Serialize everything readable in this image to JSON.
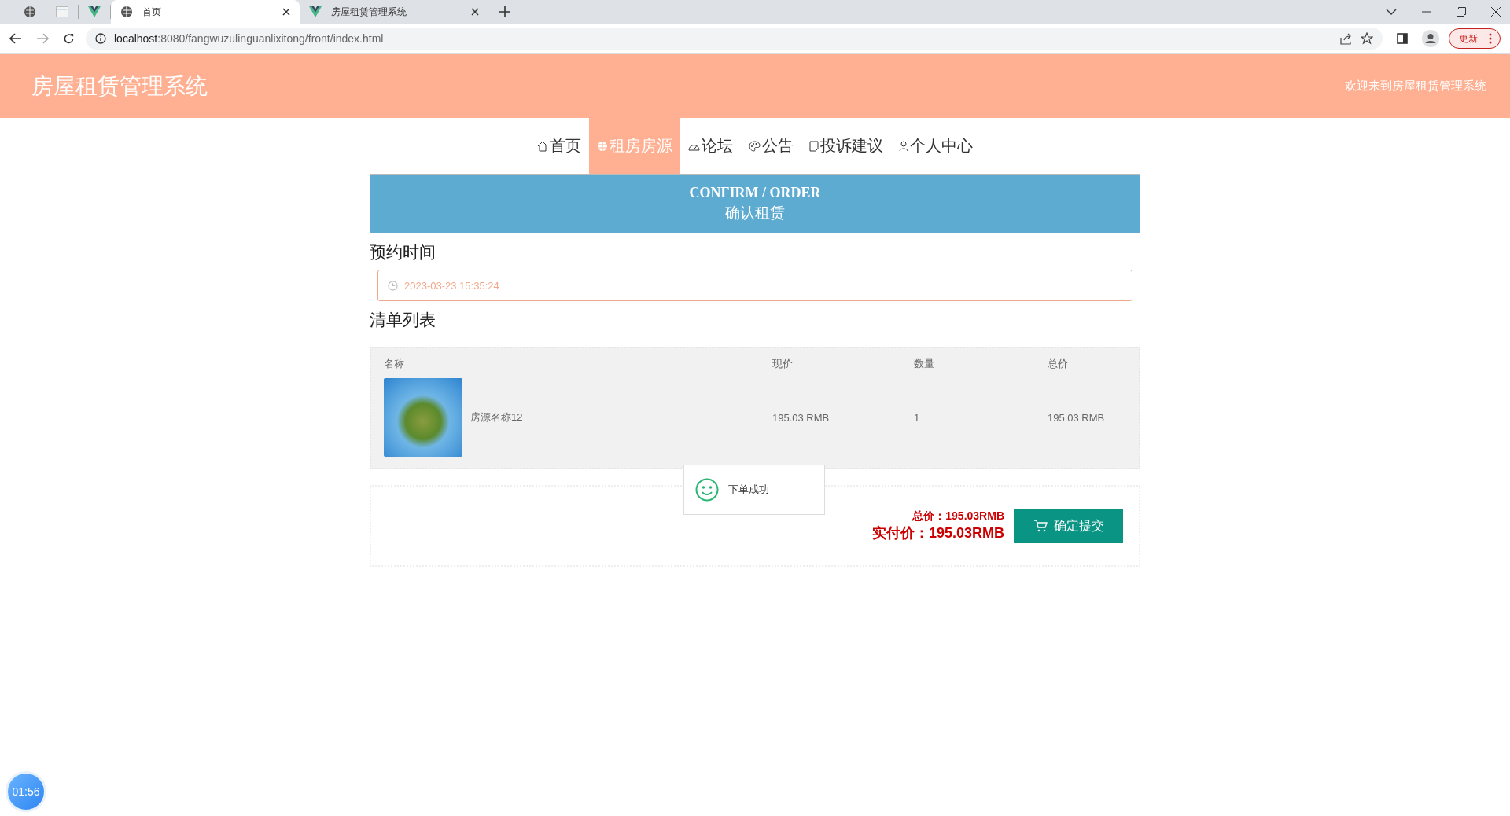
{
  "browser": {
    "tabs": [
      {
        "kind": "pinned-globe",
        "selected": false
      },
      {
        "kind": "pinned-page",
        "selected": false
      },
      {
        "kind": "pinned-vue",
        "selected": false
      },
      {
        "kind": "globe",
        "title": "首页",
        "selected": true
      },
      {
        "kind": "vue",
        "title": "房屋租赁管理系统",
        "selected": false
      }
    ],
    "url_host": "localhost",
    "url_rest": ":8080/fangwuzulinguanlixitong/front/index.html",
    "update_button": "更新"
  },
  "header": {
    "title": "房屋租赁管理系统",
    "welcome": "欢迎来到房屋租赁管理系统"
  },
  "nav": [
    {
      "kind": "home",
      "label": "首页",
      "selected": false
    },
    {
      "kind": "globe",
      "label": "租房房源",
      "selected": true
    },
    {
      "kind": "gauge",
      "label": "论坛",
      "selected": false
    },
    {
      "kind": "palette",
      "label": "公告",
      "selected": false
    },
    {
      "kind": "note",
      "label": "投诉建议",
      "selected": false
    },
    {
      "kind": "user",
      "label": "个人中心",
      "selected": false
    }
  ],
  "banner": {
    "title": "CONFIRM / ORDER",
    "subtitle": "确认租赁"
  },
  "appointment": {
    "label": "预约时间",
    "value": "2023-03-23 15:35:24"
  },
  "list": {
    "label": "清单列表",
    "columns": [
      "名称",
      "现价",
      "数量",
      "总价"
    ],
    "rows": [
      {
        "name": "房源名称12",
        "price": "195.03 RMB",
        "quantity": "1",
        "total": "195.03 RMB"
      }
    ]
  },
  "summary": {
    "original_total": "总价：195.03RMB",
    "actual_total": "实付价：195.03RMB",
    "submit_button": "确定提交"
  },
  "toast": {
    "message": "下单成功"
  },
  "timer": "01:56"
}
